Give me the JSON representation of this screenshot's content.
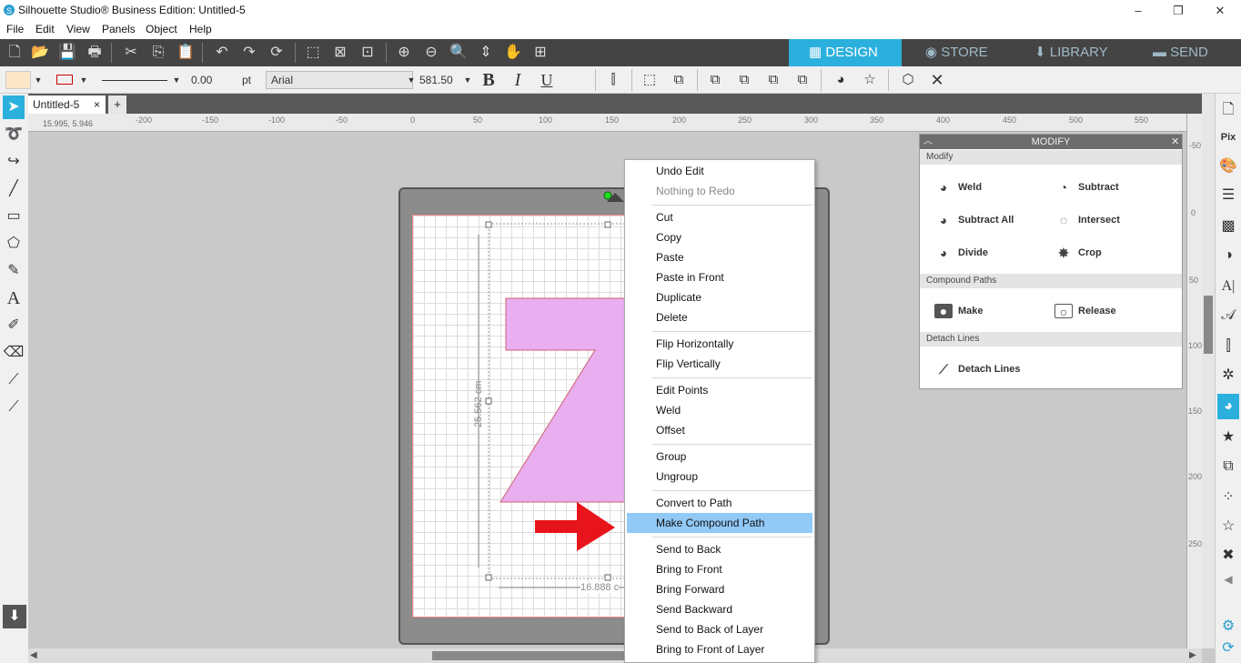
{
  "window": {
    "title": "Silhouette Studio® Business Edition: Untitled-5",
    "controls": [
      "–",
      "❐",
      "✕"
    ]
  },
  "menu": [
    "File",
    "Edit",
    "View",
    "Panels",
    "Object",
    "Help"
  ],
  "nav_tabs": [
    {
      "label": "DESIGN",
      "icon": "grid-icon"
    },
    {
      "label": "STORE",
      "icon": "store-icon"
    },
    {
      "label": "LIBRARY",
      "icon": "library-icon"
    },
    {
      "label": "SEND",
      "icon": "send-icon"
    }
  ],
  "toolbar2": {
    "line_width": "0.00",
    "line_unit": "pt",
    "font_name": "Arial",
    "font_size": "581.50",
    "bold": "B",
    "italic": "I",
    "underline": "U"
  },
  "doc_tab": {
    "label": "Untitled-5",
    "close": "×",
    "add": "+"
  },
  "coords": "15.995, 5.946",
  "ruler_top_labels": [
    "-200",
    "-150",
    "-100",
    "-50",
    "0",
    "50",
    "100",
    "150",
    "200",
    "250",
    "300",
    "350",
    "400",
    "450",
    "500",
    "550"
  ],
  "ruler_right_labels": [
    "-50",
    "0",
    "50",
    "100",
    "150",
    "200",
    "250"
  ],
  "dimensions": {
    "height": "25.562 cm",
    "width": "16.888 c"
  },
  "context_menu": [
    {
      "label": "Undo Edit",
      "disabled": false
    },
    {
      "label": "Nothing to Redo",
      "disabled": true
    },
    {
      "sep": true
    },
    {
      "label": "Cut"
    },
    {
      "label": "Copy"
    },
    {
      "label": "Paste"
    },
    {
      "label": "Paste in Front"
    },
    {
      "label": "Duplicate"
    },
    {
      "label": "Delete"
    },
    {
      "sep": true
    },
    {
      "label": "Flip Horizontally"
    },
    {
      "label": "Flip Vertically"
    },
    {
      "sep": true
    },
    {
      "label": "Edit Points"
    },
    {
      "label": "Weld"
    },
    {
      "label": "Offset"
    },
    {
      "sep": true
    },
    {
      "label": "Group"
    },
    {
      "label": "Ungroup"
    },
    {
      "sep": true
    },
    {
      "label": "Convert to Path"
    },
    {
      "label": "Make Compound Path",
      "highlight": true
    },
    {
      "sep": true
    },
    {
      "label": "Send to Back"
    },
    {
      "label": "Bring to Front"
    },
    {
      "label": "Bring Forward"
    },
    {
      "label": "Send Backward"
    },
    {
      "label": "Send to Back of Layer"
    },
    {
      "label": "Bring to Front of Layer"
    }
  ],
  "modify_panel": {
    "title": "MODIFY",
    "sections": [
      {
        "title": "Modify",
        "buttons": [
          {
            "label": "Weld",
            "icon": "weld-icon"
          },
          {
            "label": "Subtract",
            "icon": "subtract-icon"
          },
          {
            "label": "Subtract All",
            "icon": "subtract-all-icon"
          },
          {
            "label": "Intersect",
            "icon": "intersect-icon"
          },
          {
            "label": "Divide",
            "icon": "divide-icon"
          },
          {
            "label": "Crop",
            "icon": "crop-icon"
          }
        ]
      },
      {
        "title": "Compound Paths",
        "buttons": [
          {
            "label": "Make",
            "icon": "make-compound-icon"
          },
          {
            "label": "Release",
            "icon": "release-compound-icon"
          }
        ]
      },
      {
        "title": "Detach Lines",
        "buttons": [
          {
            "label": "Detach Lines",
            "icon": "detach-lines-icon"
          }
        ]
      }
    ]
  },
  "colors": {
    "accent": "#2bb0dd",
    "shape_fill": "#e8aef0",
    "arrow": "#e8141c",
    "highlight": "#91c9f7"
  }
}
